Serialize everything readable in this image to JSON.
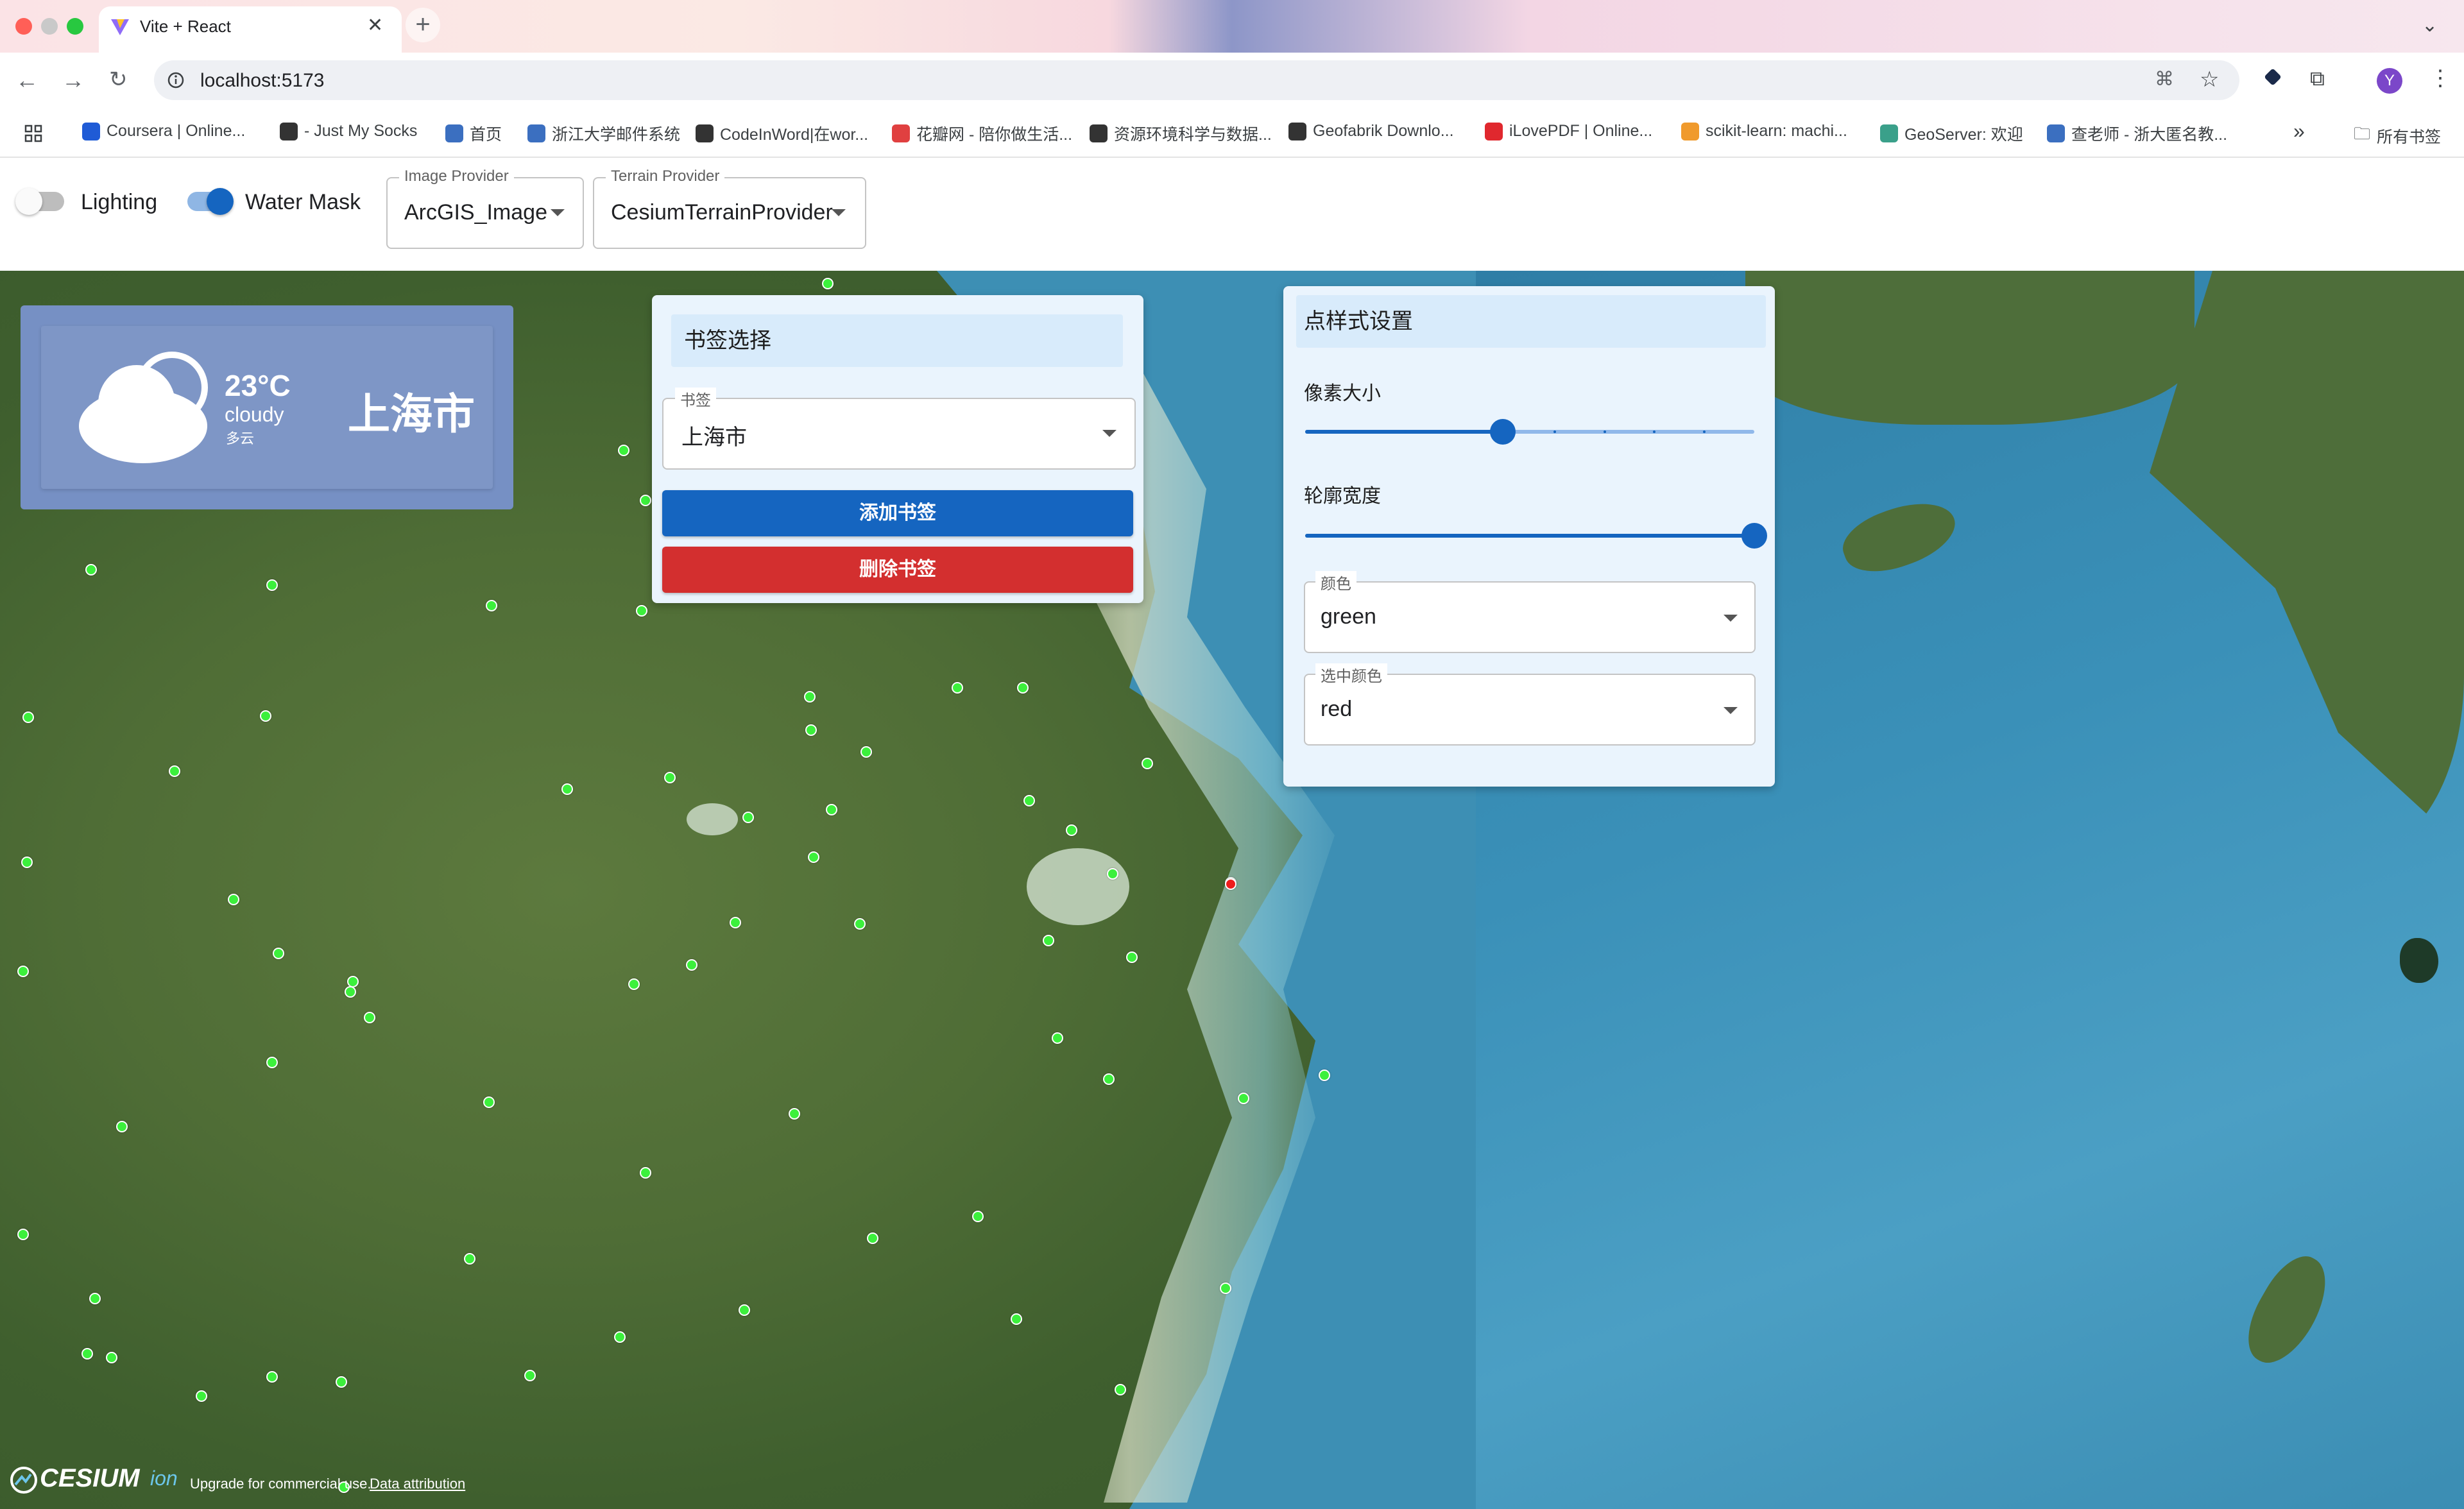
{
  "browser": {
    "tab_title": "Vite + React",
    "url": "localhost:5173",
    "bookmarks": [
      {
        "label": "Coursera | Online...",
        "color": "#1f5bd6"
      },
      {
        "label": "- Just My Socks",
        "color": "#333333"
      },
      {
        "label": "首页",
        "color": "#3b6fc0"
      },
      {
        "label": "浙江大学邮件系统",
        "color": "#3b6fc0"
      },
      {
        "label": "CodeInWord|在wor...",
        "color": "#333333"
      },
      {
        "label": "花瓣网 - 陪你做生活...",
        "color": "#e04040"
      },
      {
        "label": "资源环境科学与数据...",
        "color": "#333333"
      },
      {
        "label": "Geofabrik Downlo...",
        "color": "#333333"
      },
      {
        "label": "iLovePDF | Online...",
        "color": "#e0282e"
      },
      {
        "label": "scikit-learn: machi...",
        "color": "#f09a2c"
      },
      {
        "label": "GeoServer: 欢迎",
        "color": "#3aa08a"
      },
      {
        "label": "查老师 - 浙大匿名教...",
        "color": "#3b6fc0"
      }
    ],
    "bookmarks_folder": "所有书签",
    "profile_initial": "Y"
  },
  "controls": {
    "lighting_label": "Lighting",
    "lighting_on": false,
    "water_mask_label": "Water Mask",
    "water_mask_on": true,
    "image_provider_label": "Image Provider",
    "image_provider_value": "ArcGIS_Image",
    "terrain_provider_label": "Terrain Provider",
    "terrain_provider_value": "CesiumTerrainProvider"
  },
  "weather": {
    "temperature": "23°C",
    "condition_en": "cloudy",
    "condition_zh": "多云",
    "city": "上海市"
  },
  "bookmark_panel": {
    "title": "书签选择",
    "field_label": "书签",
    "selected": "上海市",
    "add_label": "添加书签",
    "delete_label": "删除书签"
  },
  "style_panel": {
    "title": "点样式设置",
    "pixel_size_label": "像素大小",
    "pixel_size_fraction": 0.44,
    "outline_width_label": "轮廓宽度",
    "outline_width_fraction": 1.0,
    "slider_steps": 9,
    "color_label": "颜色",
    "color_value": "green",
    "selected_color_label": "选中颜色",
    "selected_color_value": "red"
  },
  "footer": {
    "brand": "CESIUM",
    "brand_suffix": "ion",
    "upgrade_text": "Upgrade for commercial use.",
    "attribution_link": "Data attribution"
  },
  "colors": {
    "point_color": "#3cf03c",
    "selected_point_color": "#ee1c1c",
    "add_button": "#1565c0",
    "delete_button": "#d32f2f",
    "switch_on": "#1565c0"
  }
}
